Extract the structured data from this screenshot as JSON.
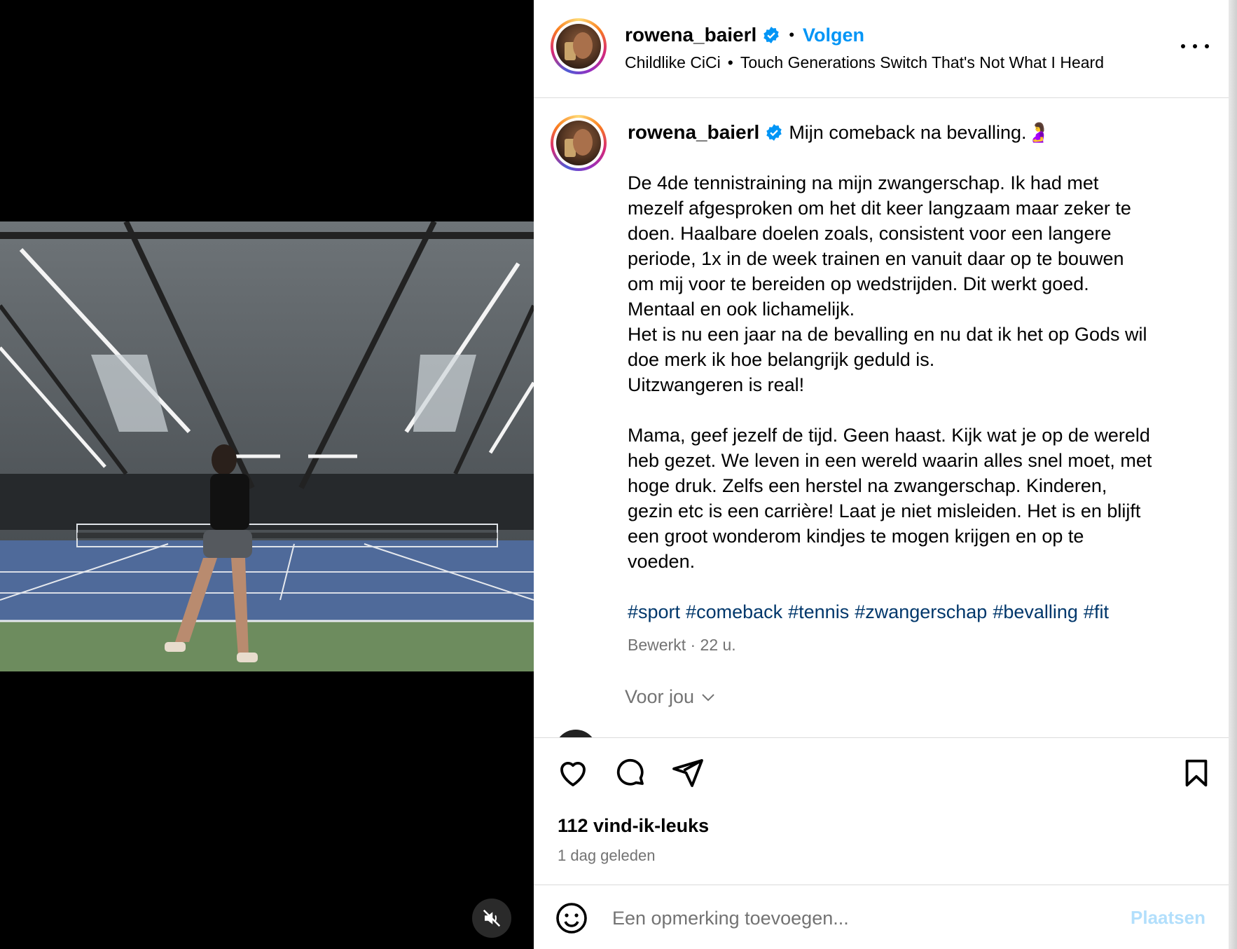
{
  "post": {
    "username": "rowena_baierl",
    "follow_label": "Volgen",
    "separator": "•",
    "audio_artist": "Childlike CiCi",
    "audio_track": "Touch Generations Switch That's Not What I Heard"
  },
  "caption": {
    "username": "rowena_baierl",
    "headline": "Mijn comeback na bevalling.🤰",
    "paragraph1": [
      "De 4de tennistraining na mijn zwangerschap. Ik had met",
      "mezelf afgesproken om het dit keer langzaam maar zeker te",
      "doen. Haalbare doelen zoals, consistent voor een langere",
      "periode, 1x in de week trainen en vanuit daar op te bouwen",
      "om mij voor te bereiden op wedstrijden. Dit werkt goed.",
      "Mentaal en ook lichamelijk.",
      "Het is nu een jaar na de bevalling en nu dat ik het op Gods wil",
      "doe merk ik hoe belangrijk geduld is.",
      "Uitzwangeren is real!"
    ],
    "paragraph2": [
      "Mama, geef jezelf de tijd. Geen haast. Kijk wat je op de wereld",
      "heb gezet. We leven in een wereld waarin alles snel moet, met",
      "hoge druk. Zelfs een herstel na zwangerschap. Kinderen,",
      "gezin etc is een carrière! Laat je niet misleiden. Het is en blijft",
      "een groot wonderom kindjes te mogen krijgen en op te",
      "voeden."
    ],
    "hashtags": [
      "#sport",
      "#comeback",
      "#tennis",
      "#zwangerschap",
      "#bevalling",
      "#fit"
    ],
    "meta": "Bewerkt · 22 u.",
    "for_you_label": "Voor jou"
  },
  "actions": {
    "likes": "112 vind-ik-leuks",
    "posted": "1 dag geleden"
  },
  "comment": {
    "placeholder": "Een opmerking toevoegen...",
    "post_label": "Plaatsen"
  },
  "colors": {
    "link": "#0095f6",
    "hashtag": "#00376b",
    "muted": "#737373",
    "post_disabled": "#b2dffc",
    "verified": "#0095f6"
  },
  "icons": [
    "verified-icon",
    "more-icon",
    "heart-icon",
    "comment-icon",
    "share-icon",
    "bookmark-icon",
    "emoji-icon",
    "muted-icon",
    "chevron-down-icon"
  ]
}
